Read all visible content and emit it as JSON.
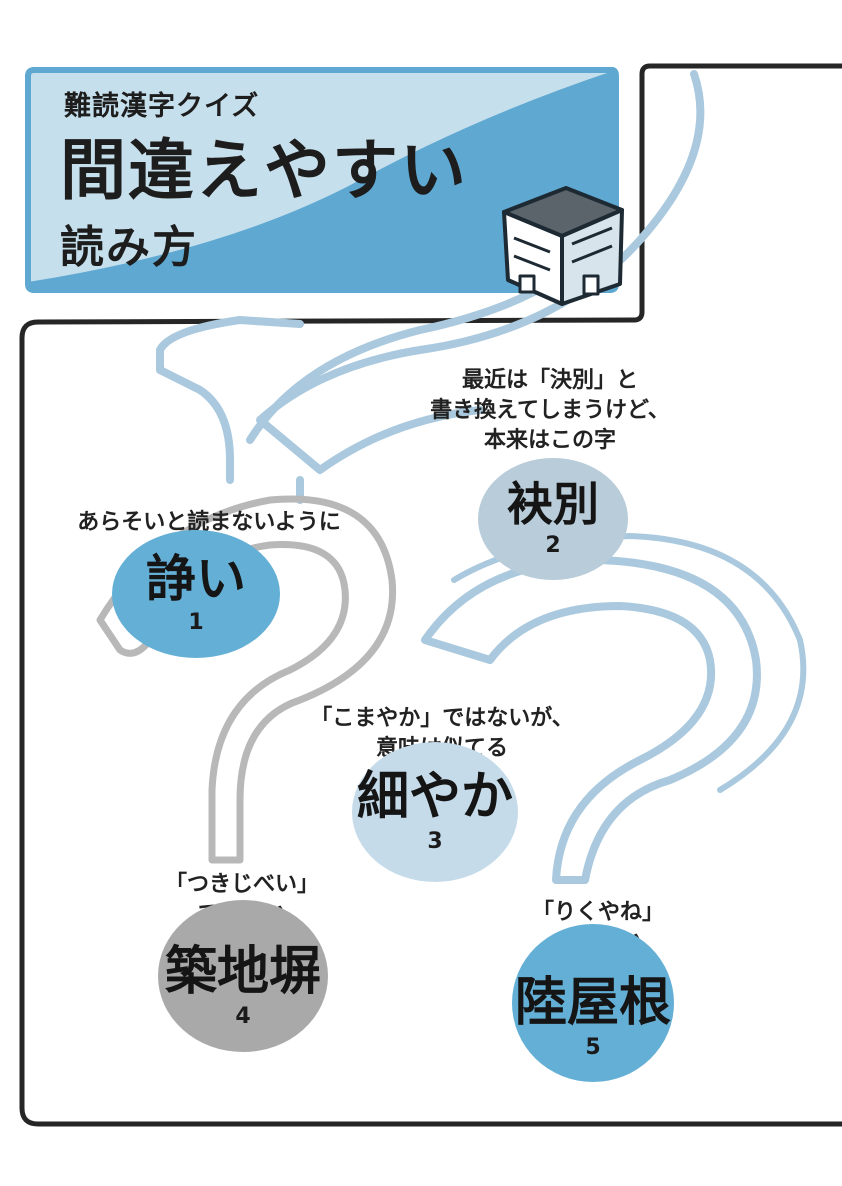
{
  "header": {
    "subtitle": "難読漢字クイズ",
    "title_line1": "間違えやすい",
    "title_line2": "読み方"
  },
  "quiz_items": [
    {
      "number": "1",
      "term": "諍い",
      "notes": [
        "あらそいと読まないように"
      ],
      "circle_color": "#64afd6"
    },
    {
      "number": "2",
      "term": "袂別",
      "notes": [
        "最近は「決別」と",
        "書き換えてしまうけど、",
        "本来はこの字"
      ],
      "circle_color": "#b8ccd9"
    },
    {
      "number": "3",
      "term": "細やか",
      "notes": [
        "「こまやか」ではないが、",
        "意味は似てる"
      ],
      "circle_color": "#c5dbea"
    },
    {
      "number": "4",
      "term": "築地塀",
      "notes": [
        "「つきじべい」",
        "ではない"
      ],
      "circle_color": "#a9a9a9"
    },
    {
      "number": "5",
      "term": "陸屋根",
      "notes": [
        "「りくやね」",
        "ではない"
      ],
      "circle_color": "#64afd6"
    }
  ],
  "colors": {
    "header_band_light": "#c6dfec",
    "header_band_dark": "#5ea8d1",
    "question_mark_blue": "#aac9de",
    "question_mark_gray": "#b8b8b8",
    "frame_border": "#262626"
  },
  "icons": [
    "building-icon",
    "question-mark-outline-icon"
  ]
}
